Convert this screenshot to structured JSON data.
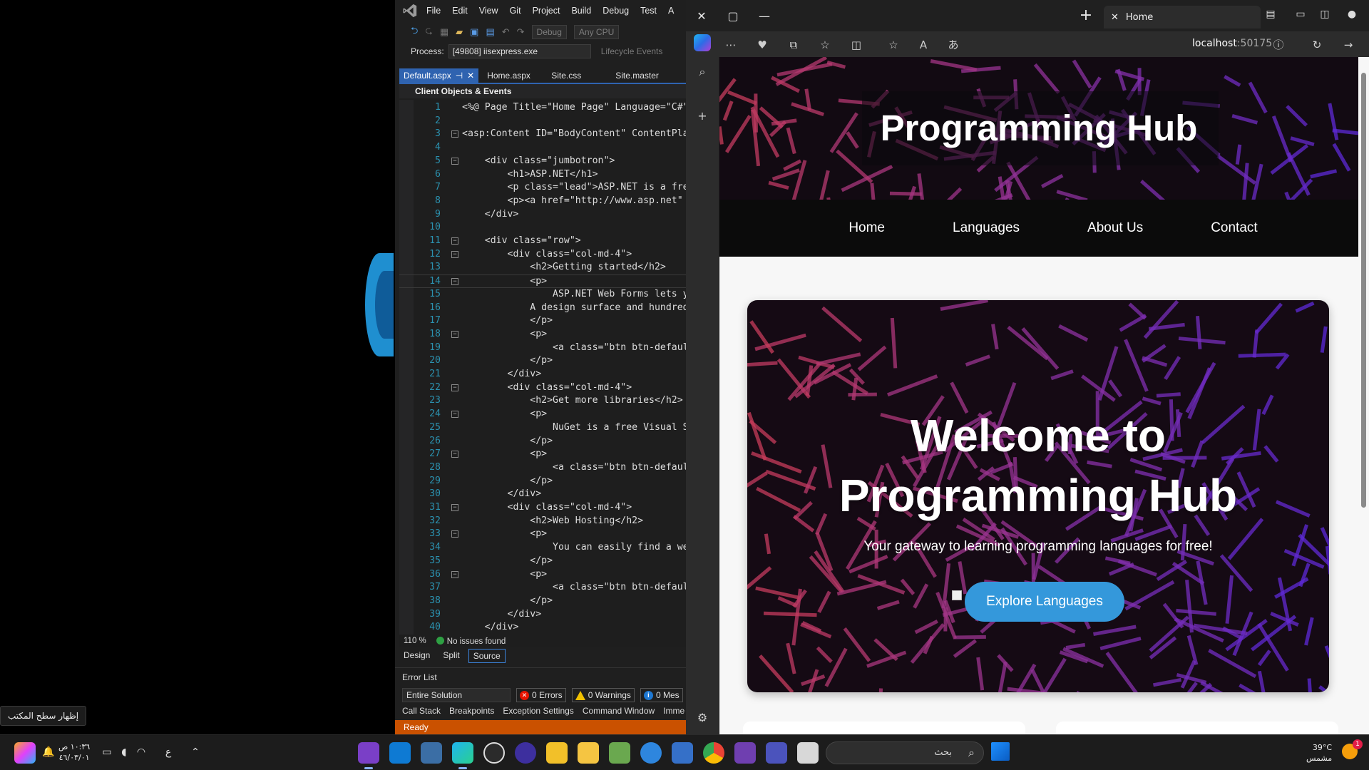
{
  "desktop": {
    "tooltip": "إظهار سطح المكتب"
  },
  "vs": {
    "menu": [
      "File",
      "Edit",
      "View",
      "Git",
      "Project",
      "Build",
      "Debug",
      "Test",
      "A"
    ],
    "toolbar": {
      "config": "Debug",
      "platform": "Any CPU"
    },
    "process": {
      "label": "Process:",
      "value": "[49808] iisexpress.exe",
      "lifecycle": "Lifecycle Events"
    },
    "tabs": {
      "active": "Default.aspx",
      "t2": "Home.aspx",
      "t3": "Site.css",
      "t4": "Site.master"
    },
    "nav_combo": "Client Objects & Events",
    "lines": [
      {
        "n": "1",
        "code": "<%@ Page Title=\"Home Page\" Language=\"C#\" "
      },
      {
        "n": "2",
        "code": ""
      },
      {
        "n": "3",
        "code": "<asp:Content ID=\"BodyContent\" ContentPlac"
      },
      {
        "n": "4",
        "code": ""
      },
      {
        "n": "5",
        "code": "    <div class=\"jumbotron\">"
      },
      {
        "n": "6",
        "code": "        <h1>ASP.NET</h1>"
      },
      {
        "n": "7",
        "code": "        <p class=\"lead\">ASP.NET is a free"
      },
      {
        "n": "8",
        "code": "        <p><a href=\"http://www.asp.net\" c"
      },
      {
        "n": "9",
        "code": "    </div>"
      },
      {
        "n": "10",
        "code": ""
      },
      {
        "n": "11",
        "code": "    <div class=\"row\">"
      },
      {
        "n": "12",
        "code": "        <div class=\"col-md-4\">"
      },
      {
        "n": "13",
        "code": "            <h2>Getting started</h2>"
      },
      {
        "n": "14",
        "code": "            <p>"
      },
      {
        "n": "15",
        "code": "                ASP.NET Web Forms lets yo"
      },
      {
        "n": "16",
        "code": "            A design surface and hundreds"
      },
      {
        "n": "17",
        "code": "            </p>"
      },
      {
        "n": "18",
        "code": "            <p>"
      },
      {
        "n": "19",
        "code": "                <a class=\"btn btn-default"
      },
      {
        "n": "20",
        "code": "            </p>"
      },
      {
        "n": "21",
        "code": "        </div>"
      },
      {
        "n": "22",
        "code": "        <div class=\"col-md-4\">"
      },
      {
        "n": "23",
        "code": "            <h2>Get more libraries</h2>"
      },
      {
        "n": "24",
        "code": "            <p>"
      },
      {
        "n": "25",
        "code": "                NuGet is a free Visual St"
      },
      {
        "n": "26",
        "code": "            </p>"
      },
      {
        "n": "27",
        "code": "            <p>"
      },
      {
        "n": "28",
        "code": "                <a class=\"btn btn-default"
      },
      {
        "n": "29",
        "code": "            </p>"
      },
      {
        "n": "30",
        "code": "        </div>"
      },
      {
        "n": "31",
        "code": "        <div class=\"col-md-4\">"
      },
      {
        "n": "32",
        "code": "            <h2>Web Hosting</h2>"
      },
      {
        "n": "33",
        "code": "            <p>"
      },
      {
        "n": "34",
        "code": "                You can easily find a web"
      },
      {
        "n": "35",
        "code": "            </p>"
      },
      {
        "n": "36",
        "code": "            <p>"
      },
      {
        "n": "37",
        "code": "                <a class=\"btn btn-default"
      },
      {
        "n": "38",
        "code": "            </p>"
      },
      {
        "n": "39",
        "code": "        </div>"
      },
      {
        "n": "40",
        "code": "    </div>"
      }
    ],
    "zoom": "110 %",
    "issues": "No issues found",
    "views": {
      "design": "Design",
      "split": "Split",
      "source": "Source"
    },
    "error_list": {
      "title": "Error List",
      "scope": "Entire Solution",
      "errors": "0 Errors",
      "warnings": "0 Warnings",
      "messages": "0 Mes",
      "links": [
        "Call Stack",
        "Breakpoints",
        "Exception Settings",
        "Command Window",
        "Imme"
      ]
    },
    "status": "Ready"
  },
  "edge": {
    "tab_title": "Home",
    "url_host": "localhost",
    "url_port": ":50175"
  },
  "site": {
    "title": "Programming Hub",
    "nav": [
      "Home",
      "Languages",
      "About Us",
      "Contact"
    ],
    "hero_title_1": "Welcome to",
    "hero_title_2": "Programming Hub",
    "hero_sub": "Your gateway to learning programming languages for free!",
    "hero_button": "Explore Languages"
  },
  "taskbar": {
    "time": "١٠:٣٦ ص",
    "date": "٤٦/٠٣/٠١",
    "search": "بحث",
    "lang": "ع",
    "weather_temp": "39°C",
    "weather_desc": "مشمس",
    "notif": "1"
  },
  "colors": {
    "vs_accent": "#2f63b0",
    "vs_status": "#ca5100",
    "hero_button": "#3498db"
  }
}
